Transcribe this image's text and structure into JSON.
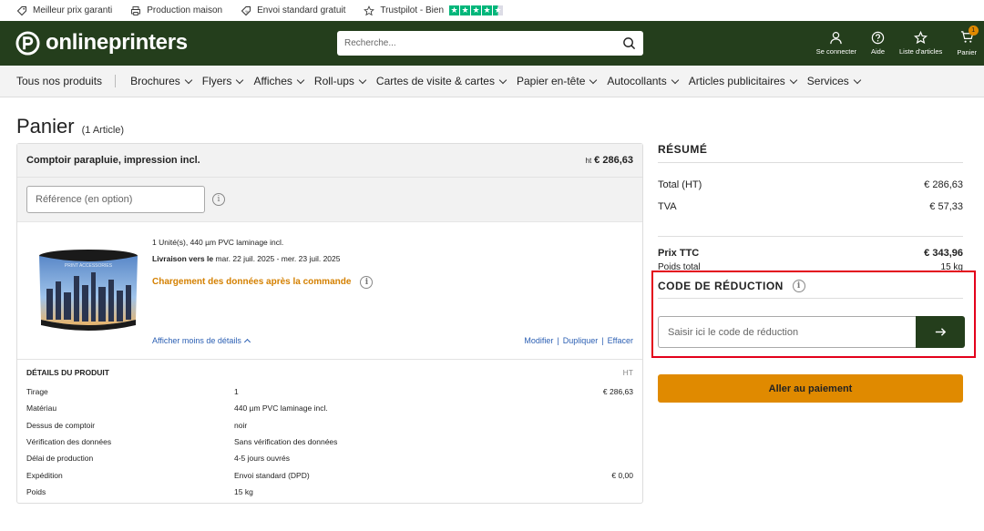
{
  "topbar": {
    "items": [
      {
        "label": "Meilleur prix garanti",
        "icon": "price-tag-icon"
      },
      {
        "label": "Production maison",
        "icon": "printer-icon"
      },
      {
        "label": "Envoi standard gratuit",
        "icon": "percent-tag-icon"
      },
      {
        "label": "Trustpilot - Bien",
        "icon": "star-outline-icon"
      }
    ],
    "trustpilot_rating": 4.5
  },
  "header": {
    "logo_text": "onlineprinters",
    "search_placeholder": "Recherche...",
    "icons": [
      {
        "label": "Se connecter",
        "icon": "user-icon"
      },
      {
        "label": "Aide",
        "icon": "help-icon"
      },
      {
        "label": "Liste d'articles",
        "icon": "star-icon"
      },
      {
        "label": "Panier",
        "icon": "cart-icon"
      }
    ],
    "cart_count": "1"
  },
  "nav": {
    "items": [
      {
        "label": "Tous nos produits",
        "dropdown": false
      },
      {
        "label": "Brochures",
        "dropdown": true
      },
      {
        "label": "Flyers",
        "dropdown": true
      },
      {
        "label": "Affiches",
        "dropdown": true
      },
      {
        "label": "Roll-ups",
        "dropdown": true
      },
      {
        "label": "Cartes de visite & cartes",
        "dropdown": true
      },
      {
        "label": "Papier en-tête",
        "dropdown": true
      },
      {
        "label": "Autocollants",
        "dropdown": true
      },
      {
        "label": "Articles publicitaires",
        "dropdown": true
      },
      {
        "label": "Services",
        "dropdown": true
      }
    ]
  },
  "page": {
    "title": "Panier",
    "count": "(1 Article)"
  },
  "cart_item": {
    "name": "Comptoir parapluie, impression incl.",
    "price_prefix": "ht",
    "price": "€ 286,63",
    "reference_placeholder": "Référence (en option)",
    "summary_line": "1 Unité(s), 440 µm PVC laminage incl.",
    "delivery_label": "Livraison vers le",
    "delivery_dates": "mar. 22 juil. 2025 - mer. 23 juil. 2025",
    "data_upload_notice": "Chargement des données après la commande",
    "less_details": "Afficher moins de détails",
    "actions": [
      "Modifier",
      "Dupliquer",
      "Effacer"
    ],
    "details_title": "DÉTAILS DU PRODUIT",
    "details_ht": "HT",
    "details": [
      {
        "key": "Tirage",
        "value": "1",
        "price": "€ 286,63"
      },
      {
        "key": "Matériau",
        "value": "440 µm PVC laminage incl.",
        "price": ""
      },
      {
        "key": "Dessus de comptoir",
        "value": "noir",
        "price": ""
      },
      {
        "key": "Vérification des données",
        "value": "Sans vérification des données",
        "price": ""
      },
      {
        "key": "Délai de production",
        "value": "4-5 jours ouvrés",
        "price": ""
      },
      {
        "key": "Expédition",
        "value": "Envoi standard (DPD)",
        "price": "€ 0,00"
      },
      {
        "key": "Poids",
        "value": "15 kg",
        "price": ""
      }
    ]
  },
  "summary": {
    "title": "RÉSUMÉ",
    "total_ht_label": "Total (HT)",
    "total_ht": "€ 286,63",
    "tva_label": "TVA",
    "tva": "€ 57,33",
    "ttc_label": "Prix TTC",
    "ttc": "€ 343,96",
    "weight_label": "Poids total",
    "weight": "15 kg"
  },
  "discount": {
    "title": "CODE DE RÉDUCTION",
    "placeholder": "Saisir ici le code de réduction"
  },
  "pay_button": "Aller au paiement",
  "colors": {
    "brand_green": "#243e1c",
    "accent_orange": "#e08a00",
    "trustpilot_green": "#00b67a",
    "highlight_red": "#e3001b",
    "link_blue": "#2b5fb3"
  }
}
